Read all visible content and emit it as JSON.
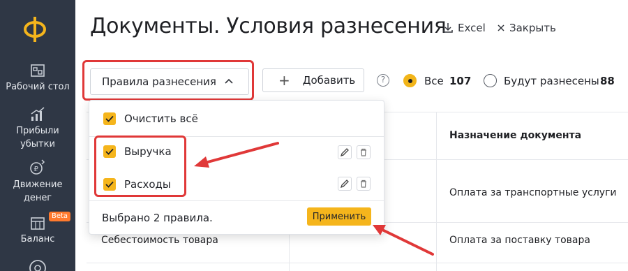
{
  "sidebar": {
    "logo": "Ф",
    "items": [
      {
        "label": "Рабочий стол",
        "icon": "dashboard-icon"
      },
      {
        "label": "Прибыли убытки",
        "icon": "chart-up-icon"
      },
      {
        "label": "Движение денег",
        "icon": "money-flow-icon"
      },
      {
        "label": "Баланс",
        "icon": "balance-icon",
        "badge": "Beta"
      }
    ]
  },
  "header": {
    "title": "Документы. Условия разнесения",
    "excel_label": "Excel",
    "close_label": "Закрыть"
  },
  "toolbar": {
    "rules_label": "Правила разнесения",
    "add_label": "Добавить",
    "help": "?",
    "filters": [
      {
        "label": "Все",
        "count": "107",
        "selected": true
      },
      {
        "label": "Будут разнесены",
        "count": "88",
        "selected": false
      }
    ]
  },
  "dropdown": {
    "clear_all": "Очистить всё",
    "rules": [
      {
        "label": "Выручка",
        "checked": true
      },
      {
        "label": "Расходы",
        "checked": true
      }
    ],
    "selected_text": "Выбрано 2 правила.",
    "apply_label": "Применить"
  },
  "table": {
    "columns": [
      "Назначение документа"
    ],
    "rows": [
      {
        "col1": "",
        "purpose": "Оплата за транспортные услуги"
      },
      {
        "col1": "Себестоимость товара",
        "purpose": "Оплата за поставку товара"
      }
    ]
  },
  "colors": {
    "sidebar_bg": "#2f3745",
    "accent": "#f5b51c",
    "annotation_red": "#e03838"
  }
}
